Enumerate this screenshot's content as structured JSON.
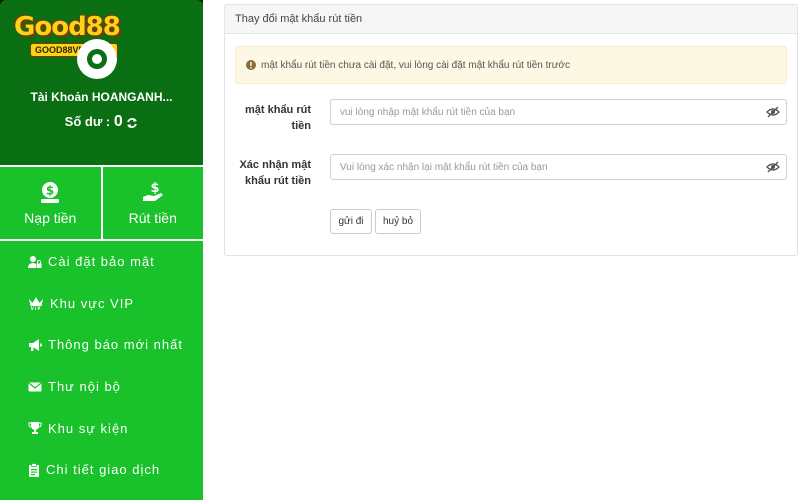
{
  "brand": {
    "logo_text": "Good88",
    "logo_tag": "GOOD88VN.SHOP"
  },
  "profile": {
    "account_label": "Tài Khoản HOANGANH...",
    "balance_label": "Số dư :",
    "balance_value": "0"
  },
  "actions": [
    {
      "label": "Nạp tiền",
      "icon": "deposit-icon"
    },
    {
      "label": "Rút tiền",
      "icon": "withdraw-icon"
    }
  ],
  "menu": [
    {
      "label": "Cài đặt bảo mật",
      "icon": "user-lock-icon"
    },
    {
      "label": "Khu vực VIP",
      "icon": "crown-icon"
    },
    {
      "label": "Thông báo mới nhất",
      "icon": "megaphone-icon"
    },
    {
      "label": "Thư nội bộ",
      "icon": "envelope-icon"
    },
    {
      "label": "Khu sự kiện",
      "icon": "trophy-icon"
    },
    {
      "label": "Chi tiết giao dịch",
      "icon": "clipboard-icon"
    }
  ],
  "panel": {
    "title": "Thay đổi mật khẩu rút tiền",
    "alert": "mật khẩu rút tiền chưa cài đặt, vui lòng cài đặt mật khẩu rút tiền trước",
    "fields": [
      {
        "label_line1": "mật khẩu rút",
        "label_line2": "tiền",
        "placeholder": "vui lòng nhập mật khẩu rút tiền của bạn"
      },
      {
        "label_line1": "Xác nhận mật",
        "label_line2": "khẩu rút tiền",
        "placeholder": "Vui lòng xác nhận lại mật khẩu rút tiền của bạn"
      }
    ],
    "submit_label": "gửi đi",
    "cancel_label": "huỷ bỏ"
  },
  "colors": {
    "sidebar_green": "#19c12a",
    "profile_green": "#0a6e12",
    "alert_bg": "#fcf8e3",
    "logo_yellow": "#ffd21a"
  }
}
